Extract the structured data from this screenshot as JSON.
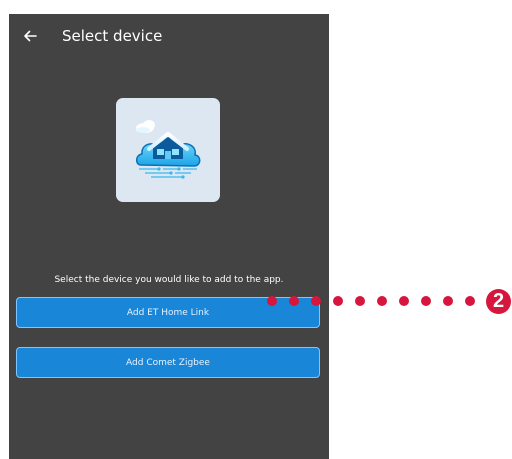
{
  "header": {
    "back_icon": "arrow-left-icon",
    "title": "Select device"
  },
  "hero": {
    "illustration": "smart-home-cloud-illustration"
  },
  "main": {
    "instruction": "Select the device you would like to add to the app.",
    "buttons": [
      {
        "label": "Add ET Home Link"
      },
      {
        "label": "Add Comet Zigbee"
      }
    ]
  },
  "callout": {
    "number": "2",
    "color": "#d6163c"
  },
  "colors": {
    "background": "#434343",
    "button": "#1a86d8",
    "button_border": "#7ec6ff",
    "card": "#dde7f2"
  }
}
